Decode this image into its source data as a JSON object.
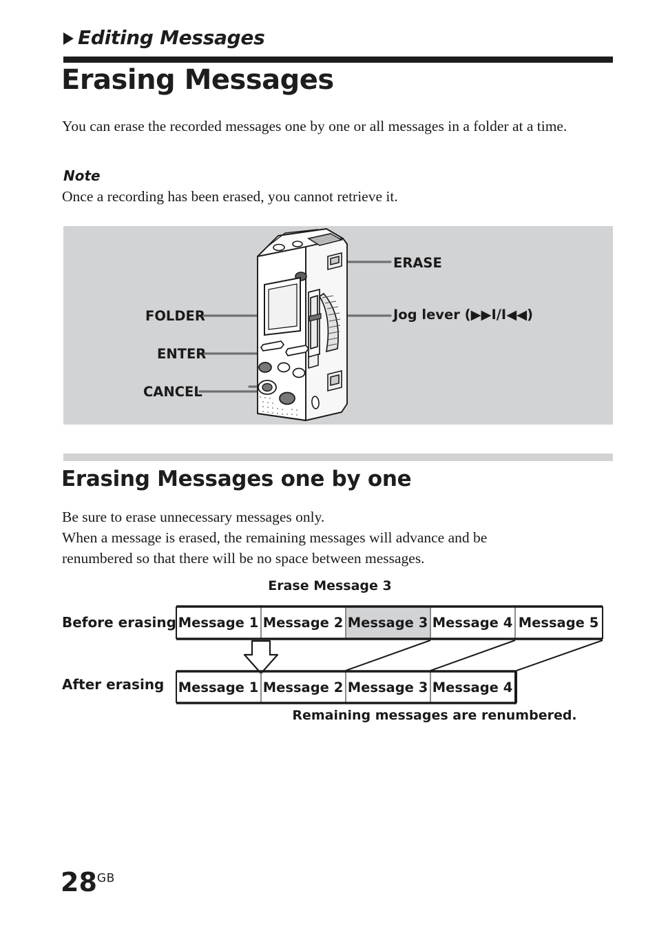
{
  "running_head": {
    "marker": "triangle-right",
    "text": "Editing Messages"
  },
  "chapter_title": "Erasing Messages",
  "intro_paragraph": "You can erase the recorded messages one by one or all messages in a folder at a time.",
  "note": {
    "label": "Note",
    "text": "Once a recording has been erased, you cannot retrieve it."
  },
  "illustration": {
    "device": "ic-recorder",
    "background_color": "#d2d3d5",
    "callouts": [
      {
        "label": "ERASE",
        "side": "right"
      },
      {
        "label": "Jog lever (▶▶I/I◀◀)",
        "side": "right"
      },
      {
        "label": "FOLDER",
        "side": "left"
      },
      {
        "label": "ENTER",
        "side": "left"
      },
      {
        "label": "CANCEL",
        "side": "left"
      }
    ]
  },
  "section": {
    "title": "Erasing Messages one by one",
    "body_line_1": "Be sure to erase unnecessary messages only.",
    "body_line_2": "When a message is erased, the remaining messages will advance and be",
    "body_line_3": "renumbered so that there will be no space between messages."
  },
  "diagram": {
    "heading": "Erase Message 3",
    "before_label": "Before erasing",
    "after_label": "After erasing",
    "caption": "Remaining messages are renumbered.",
    "highlight_color": "#d2d3d5",
    "before_cells": [
      {
        "label": "Message 1",
        "highlighted": false
      },
      {
        "label": "Message 2",
        "highlighted": false
      },
      {
        "label": "Message 3",
        "highlighted": true
      },
      {
        "label": "Message 4",
        "highlighted": false
      },
      {
        "label": "Message 5",
        "highlighted": false
      }
    ],
    "after_cells": [
      {
        "label": "Message 1"
      },
      {
        "label": "Message 2"
      },
      {
        "label": "Message 3"
      },
      {
        "label": "Message 4"
      }
    ]
  },
  "folio": {
    "page_number": "28",
    "region_code": "GB"
  }
}
